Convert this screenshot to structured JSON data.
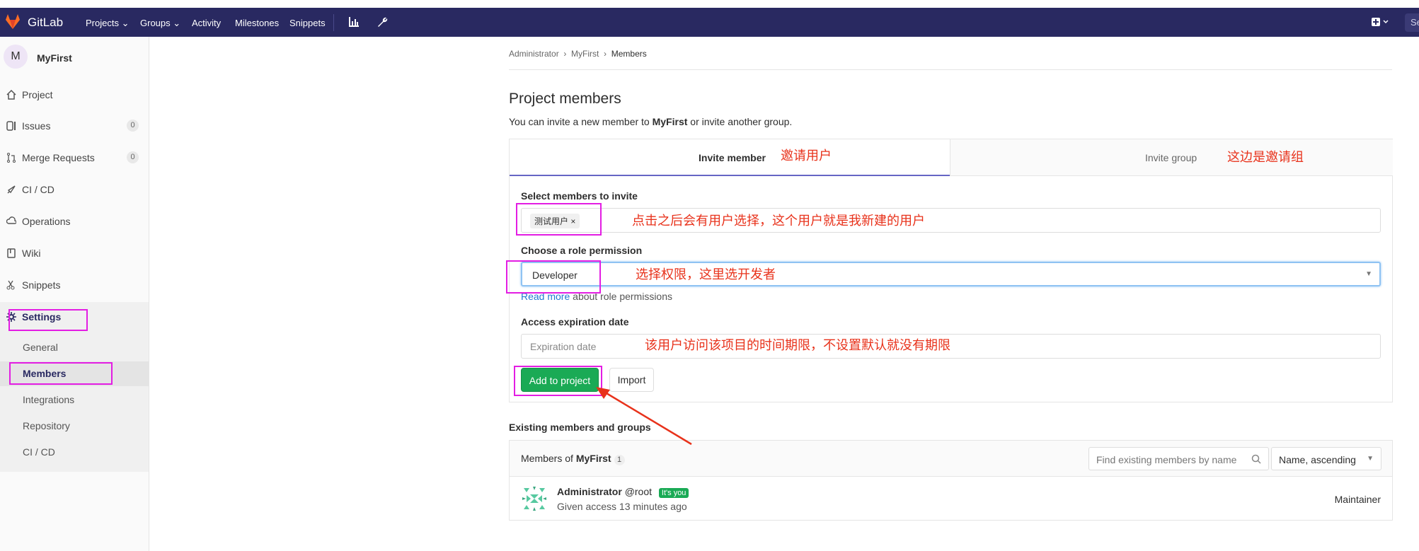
{
  "navbar": {
    "brand": "GitLab",
    "items": [
      "Projects ⌄",
      "Groups ⌄",
      "Activity",
      "Milestones",
      "Snippets"
    ],
    "search_stub": "Se",
    "colors": {
      "bg": "#292961",
      "brand_orange": "#e24329"
    }
  },
  "sidebar": {
    "project_initial": "M",
    "project_name": "MyFirst",
    "items": [
      {
        "label": "Project",
        "icon": "home-icon"
      },
      {
        "label": "Issues",
        "icon": "issues-icon",
        "badge": "0"
      },
      {
        "label": "Merge Requests",
        "icon": "merge-request-icon",
        "badge": "0"
      },
      {
        "label": "CI / CD",
        "icon": "rocket-icon"
      },
      {
        "label": "Operations",
        "icon": "cloud-gear-icon"
      },
      {
        "label": "Wiki",
        "icon": "book-icon"
      },
      {
        "label": "Snippets",
        "icon": "scissors-icon"
      },
      {
        "label": "Settings",
        "icon": "settings-gear-icon"
      }
    ],
    "settings_sub": [
      "General",
      "Members",
      "Integrations",
      "Repository",
      "CI / CD"
    ]
  },
  "breadcrumb": {
    "a": "Administrator",
    "b": "MyFirst",
    "c": "Members"
  },
  "page": {
    "title": "Project members",
    "intro_pre": "You can invite a new member to ",
    "intro_project": "MyFirst",
    "intro_post": " or invite another group."
  },
  "tabs": {
    "invite_member": "Invite member",
    "invite_group": "Invite group"
  },
  "form": {
    "select_label": "Select members to invite",
    "token": "测试用户",
    "token_remove": "×",
    "role_label": "Choose a role permission",
    "role_value": "Developer",
    "help_link": "Read more",
    "help_text": " about role permissions",
    "expiry_label": "Access expiration date",
    "expiry_placeholder": "Expiration date",
    "add_button": "Add to project",
    "import_button": "Import"
  },
  "existing": {
    "title": "Existing members and groups",
    "members_of": "Members of ",
    "project": "MyFirst",
    "count": "1",
    "search_placeholder": "Find existing members by name",
    "sort_value": "Name, ascending",
    "member": {
      "name": "Administrator",
      "username": "@root",
      "badge": "It's you",
      "access": "Given access 13 minutes ago",
      "role": "Maintainer"
    }
  },
  "annotations": {
    "invite_user": "邀请用户",
    "invite_group": "这边是邀请组",
    "select_user": "点击之后会有用户选择，这个用户就是我新建的用户",
    "choose_role": "选择权限，这里选开发者",
    "expiry": "该用户访问该项目的时间期限，不设置默认就没有期限"
  }
}
